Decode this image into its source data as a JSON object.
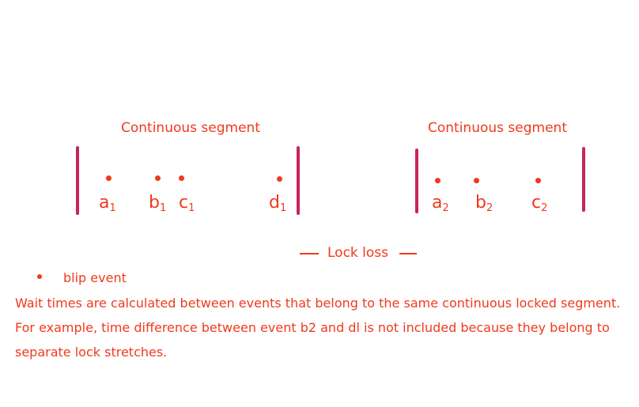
{
  "segments": [
    {
      "title": "Continuous segment",
      "events": [
        {
          "label": "a",
          "sub": "1"
        },
        {
          "label": "b",
          "sub": "1"
        },
        {
          "label": "c",
          "sub": "1"
        },
        {
          "label": "d",
          "sub": "1"
        }
      ]
    },
    {
      "title": "Continuous segment",
      "events": [
        {
          "label": "a",
          "sub": "2"
        },
        {
          "label": "b",
          "sub": "2"
        },
        {
          "label": "c",
          "sub": "2"
        }
      ]
    }
  ],
  "lock_loss": "Lock loss",
  "legend": {
    "label": "blip event"
  },
  "notes": [
    "Wait times are calculated between events that belong to the same continuous locked segment.",
    "For example, time difference between event b2 and dl is not included because they belong to",
    "separate lock stretches."
  ],
  "colors": {
    "text": "#f03a1c",
    "bar": "#c8245c"
  }
}
